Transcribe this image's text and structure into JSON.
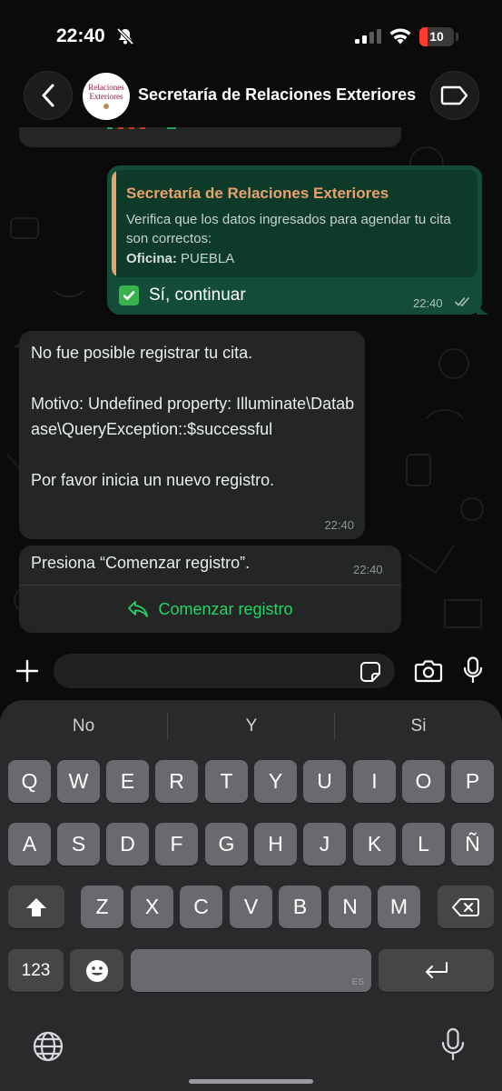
{
  "status_bar": {
    "time": "22:40",
    "battery_level": "10",
    "icons": [
      "bell-slash-icon",
      "signal-icon",
      "wifi-icon",
      "battery-icon"
    ]
  },
  "header": {
    "avatar_text": "Relaciones Exteriores",
    "title": "Secretaría de Relaciones Exteriores",
    "icons": [
      "chevron-left-icon",
      "label-tag-icon"
    ]
  },
  "messages": {
    "outgoing": {
      "quote_title": "Secretaría de Relaciones Exteriores",
      "quote_text": "Verifica que los datos ingresados para agendar tu cita son correctos:",
      "quote_office_label": "Oficina:",
      "quote_office_value": "PUEBLA",
      "reply_text": "Sí, continuar",
      "time": "22:40"
    },
    "incoming_error": {
      "line1": "No fue posible registrar tu cita.",
      "line2": "Motivo: Undefined property: Illuminate\\Database\\QueryException::$successful",
      "line3": "Por favor inicia un nuevo registro.",
      "time": "22:40"
    },
    "incoming_prompt": {
      "text": "Presiona “Comenzar registro”.",
      "time": "22:40",
      "action_label": "Comenzar registro"
    }
  },
  "input_bar": {
    "placeholder": "",
    "icons": [
      "plus-icon",
      "sticker-icon",
      "camera-icon",
      "microphone-icon"
    ]
  },
  "keyboard": {
    "suggestions": [
      "No",
      "Y",
      "Si"
    ],
    "row1": [
      "Q",
      "W",
      "E",
      "R",
      "T",
      "Y",
      "U",
      "I",
      "O",
      "P"
    ],
    "row2": [
      "A",
      "S",
      "D",
      "F",
      "G",
      "H",
      "J",
      "K",
      "L",
      "Ñ"
    ],
    "row3": [
      "Z",
      "X",
      "C",
      "V",
      "B",
      "N",
      "M"
    ],
    "numbers_label": "123",
    "space_lang": "ES",
    "icons": [
      "shift-icon",
      "backspace-icon",
      "emoji-icon",
      "return-icon",
      "globe-icon",
      "dictation-mic-icon"
    ]
  },
  "colors": {
    "accent_green": "#25d366",
    "outgoing_bubble": "#144d37",
    "incoming_bubble": "#242626",
    "quote_accent": "#e8a26b"
  }
}
